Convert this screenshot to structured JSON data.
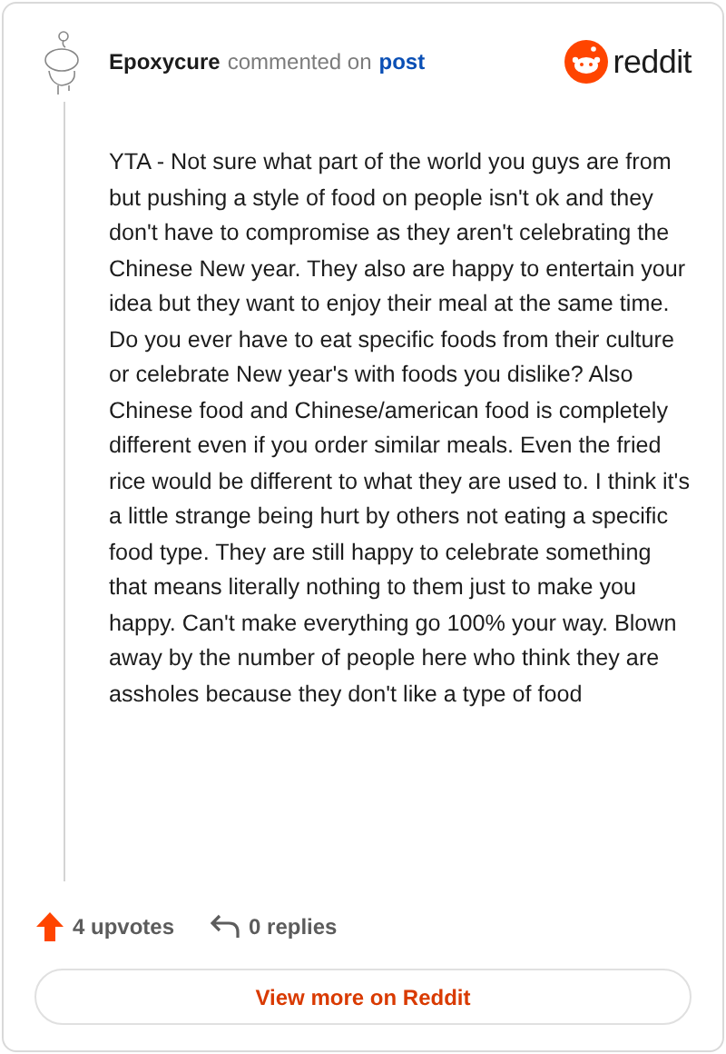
{
  "header": {
    "author": "Epoxycure",
    "action": "commented on",
    "link": "post",
    "logo_text": "reddit"
  },
  "comment": "YTA - Not sure what part of the world you guys are from but pushing a style of food on people isn't ok and they don't have to compromise as they aren't celebrating the Chinese New year. They also are happy to entertain your idea but they want to enjoy their meal at the same time. Do you ever have to eat specific foods from their culture or celebrate New year's with foods you dislike? Also Chinese food and Chinese/american food is completely different even if you order similar meals. Even the fried rice would be different to what they are used to. I think it's a little strange being hurt by others not eating a specific food type. They are still happy to celebrate something that means literally nothing to them just to make you happy. Can't make everything go 100% your way. Blown away by the number of people here who think they are assholes because they don't like a type of food",
  "stats": {
    "upvotes": "4 upvotes",
    "replies": "0 replies"
  },
  "button": "View more on Reddit"
}
